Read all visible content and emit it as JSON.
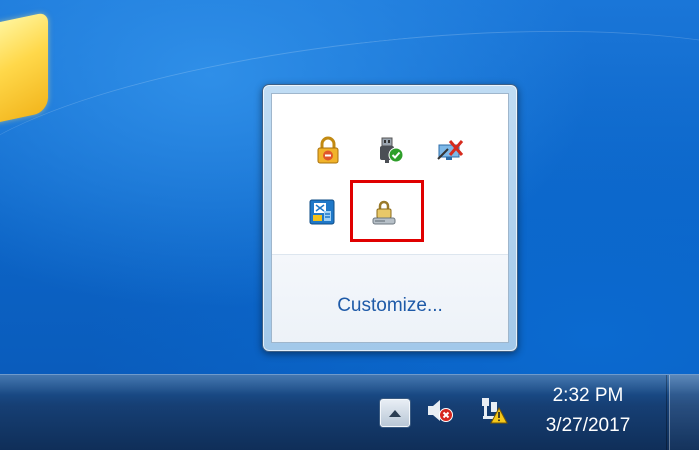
{
  "desktop": {
    "background_color": "#0c64c6"
  },
  "tray_popup": {
    "icons": [
      {
        "name": "security-lock-icon"
      },
      {
        "name": "usb-safely-remove-icon"
      },
      {
        "name": "network-disconnected-icon"
      },
      {
        "name": "blue-app-icon"
      },
      {
        "name": "lock-drive-icon"
      }
    ],
    "highlight_color": "#e00000",
    "customize_label": "Customize..."
  },
  "taskbar": {
    "show_hidden_icons": "up-arrow-icon",
    "volume": "volume-muted-icon",
    "network": "network-warning-icon",
    "clock": {
      "time": "2:32 PM",
      "date": "3/27/2017"
    }
  }
}
